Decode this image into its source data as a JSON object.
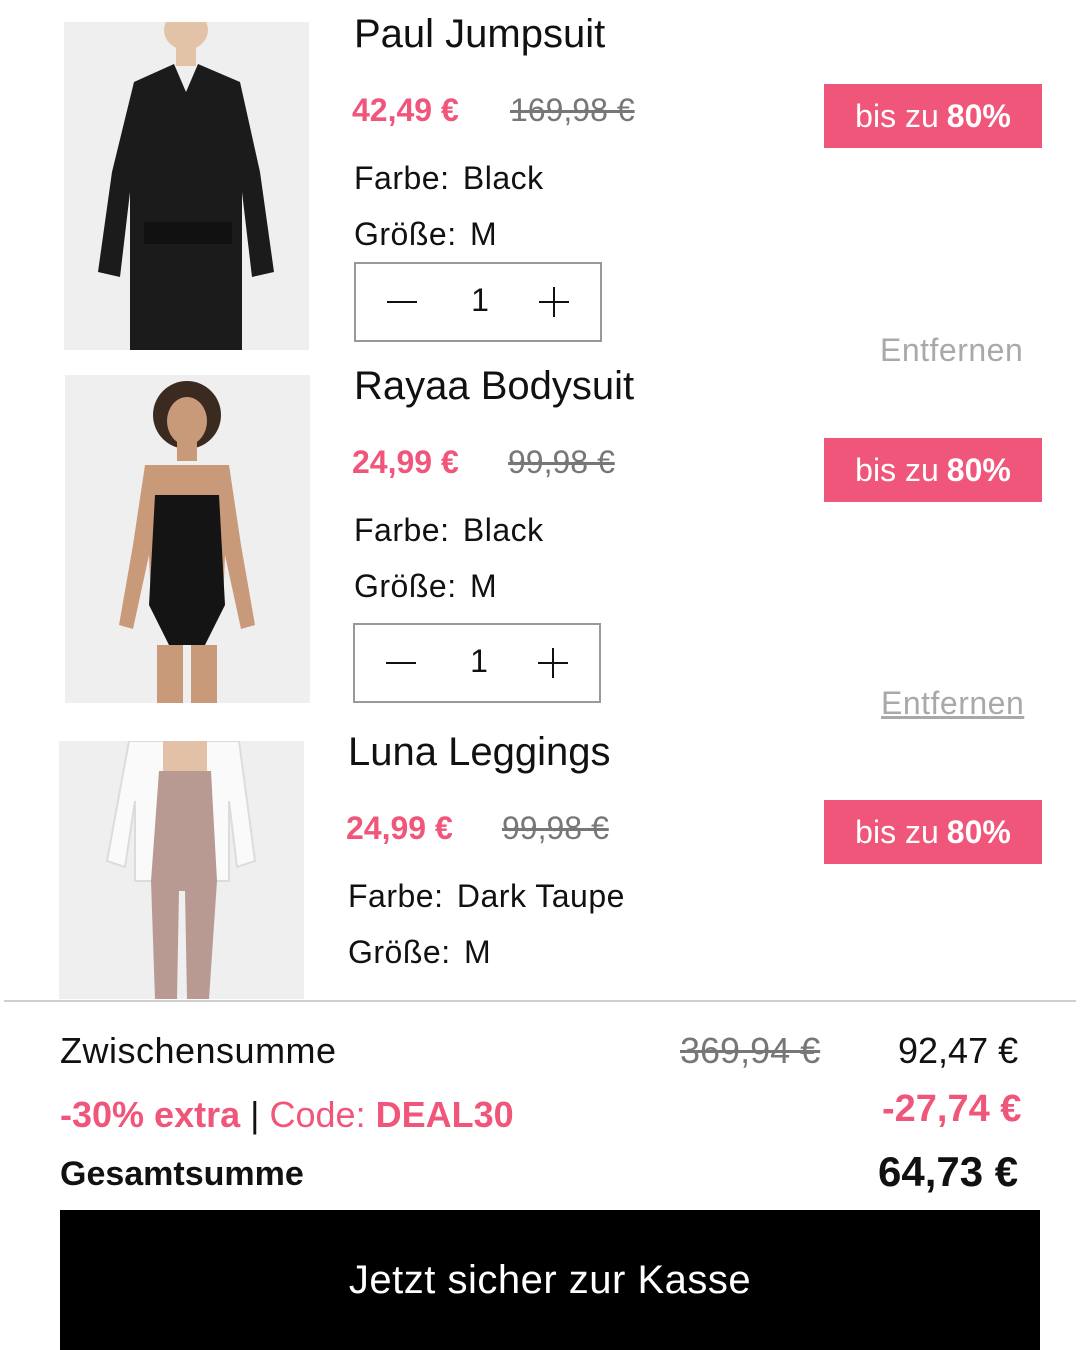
{
  "items": [
    {
      "name": "Paul Jumpsuit",
      "sale_price": "42,49 €",
      "original_price": "169,98 €",
      "badge_prefix": "bis zu",
      "badge_value": "80%",
      "color_label": "Farbe:",
      "color_value": "Black",
      "size_label": "Größe:",
      "size_value": "M",
      "quantity": "1",
      "remove_label": "Entfernen",
      "image_icon": "product-photo-black-jumpsuit"
    },
    {
      "name": "Rayaa Bodysuit",
      "sale_price": "24,99 €",
      "original_price": "99,98 €",
      "badge_prefix": "bis zu",
      "badge_value": "80%",
      "color_label": "Farbe:",
      "color_value": "Black",
      "size_label": "Größe:",
      "size_value": "M",
      "quantity": "1",
      "remove_label": "Entfernen",
      "image_icon": "product-photo-black-bodysuit"
    },
    {
      "name": "Luna Leggings",
      "sale_price": "24,99 €",
      "original_price": "99,98 €",
      "badge_prefix": "bis zu",
      "badge_value": "80%",
      "color_label": "Farbe:",
      "color_value": "Dark Taupe",
      "size_label": "Größe:",
      "size_value": "M",
      "image_icon": "product-photo-taupe-leggings"
    }
  ],
  "summary": {
    "subtotal_label": "Zwischensumme",
    "subtotal_original": "369,94 €",
    "subtotal_value": "92,47 €",
    "discount_label_highlight": "-30% extra",
    "discount_label_separator": "|",
    "discount_label_code": "Code:",
    "discount_code": "DEAL30",
    "discount_value": "-27,74 €",
    "total_label": "Gesamtsumme",
    "total_value": "64,73 €"
  },
  "checkout": {
    "label": "Jetzt sicher zur Kasse"
  },
  "colors": {
    "accent": "#f0567a",
    "button_bg": "#000000",
    "muted": "#a9a9a9"
  }
}
